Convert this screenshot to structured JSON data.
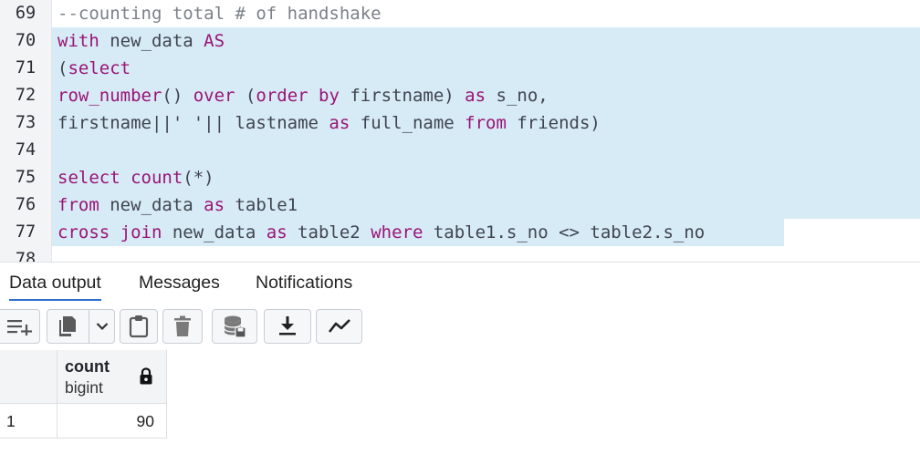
{
  "editor": {
    "lines": [
      {
        "num": "69",
        "tokens": [
          {
            "t": "--counting total # of handshake",
            "c": "cm"
          }
        ]
      },
      {
        "num": "70",
        "tokens": [
          {
            "t": "with",
            "c": "kw"
          },
          {
            "t": " new_data ",
            "c": "pl"
          },
          {
            "t": "AS",
            "c": "kw"
          }
        ]
      },
      {
        "num": "71",
        "tokens": [
          {
            "t": "(",
            "c": "pl"
          },
          {
            "t": "select",
            "c": "kw"
          }
        ]
      },
      {
        "num": "72",
        "tokens": [
          {
            "t": "row_number",
            "c": "kw"
          },
          {
            "t": "() ",
            "c": "pl"
          },
          {
            "t": "over",
            "c": "kw"
          },
          {
            "t": " (",
            "c": "pl"
          },
          {
            "t": "order by",
            "c": "kw"
          },
          {
            "t": " firstname) ",
            "c": "pl"
          },
          {
            "t": "as",
            "c": "kw"
          },
          {
            "t": " s_no,",
            "c": "pl"
          }
        ]
      },
      {
        "num": "73",
        "tokens": [
          {
            "t": "firstname||' '|| lastname ",
            "c": "pl"
          },
          {
            "t": "as",
            "c": "kw"
          },
          {
            "t": " full_name ",
            "c": "pl"
          },
          {
            "t": "from",
            "c": "kw"
          },
          {
            "t": " friends)",
            "c": "pl"
          }
        ]
      },
      {
        "num": "74",
        "tokens": []
      },
      {
        "num": "75",
        "tokens": [
          {
            "t": "select",
            "c": "kw"
          },
          {
            "t": " ",
            "c": "pl"
          },
          {
            "t": "count",
            "c": "kw"
          },
          {
            "t": "(*)",
            "c": "pl"
          }
        ]
      },
      {
        "num": "76",
        "tokens": [
          {
            "t": "from",
            "c": "kw"
          },
          {
            "t": " new_data ",
            "c": "pl"
          },
          {
            "t": "as",
            "c": "kw"
          },
          {
            "t": " table1",
            "c": "pl"
          }
        ]
      },
      {
        "num": "77",
        "tokens": [
          {
            "t": "cross join",
            "c": "kw"
          },
          {
            "t": " new_data ",
            "c": "pl"
          },
          {
            "t": "as",
            "c": "kw"
          },
          {
            "t": " table2 ",
            "c": "pl"
          },
          {
            "t": "where",
            "c": "kw"
          },
          {
            "t": " table1.s_no <> table2.s_no",
            "c": "pl"
          }
        ]
      },
      {
        "num": "78",
        "tokens": []
      }
    ]
  },
  "panel": {
    "tabs": [
      "Data output",
      "Messages",
      "Notifications"
    ],
    "active_tab": "Data output"
  },
  "toolbar": {
    "icons": [
      "add-row-icon",
      "copy-icon",
      "chevron-down-icon",
      "paste-icon",
      "delete-icon",
      "save-data-icon",
      "download-icon",
      "graph-icon"
    ]
  },
  "grid": {
    "columns": [
      {
        "name": "count",
        "type": "bigint"
      }
    ],
    "rows": [
      {
        "num": "1",
        "values": [
          "90"
        ]
      }
    ]
  },
  "colors": {
    "keyword": "#9a1375",
    "comment": "#7c8088",
    "selection": "#d7ebf6",
    "active_tab_underline": "#2c6fcc"
  }
}
